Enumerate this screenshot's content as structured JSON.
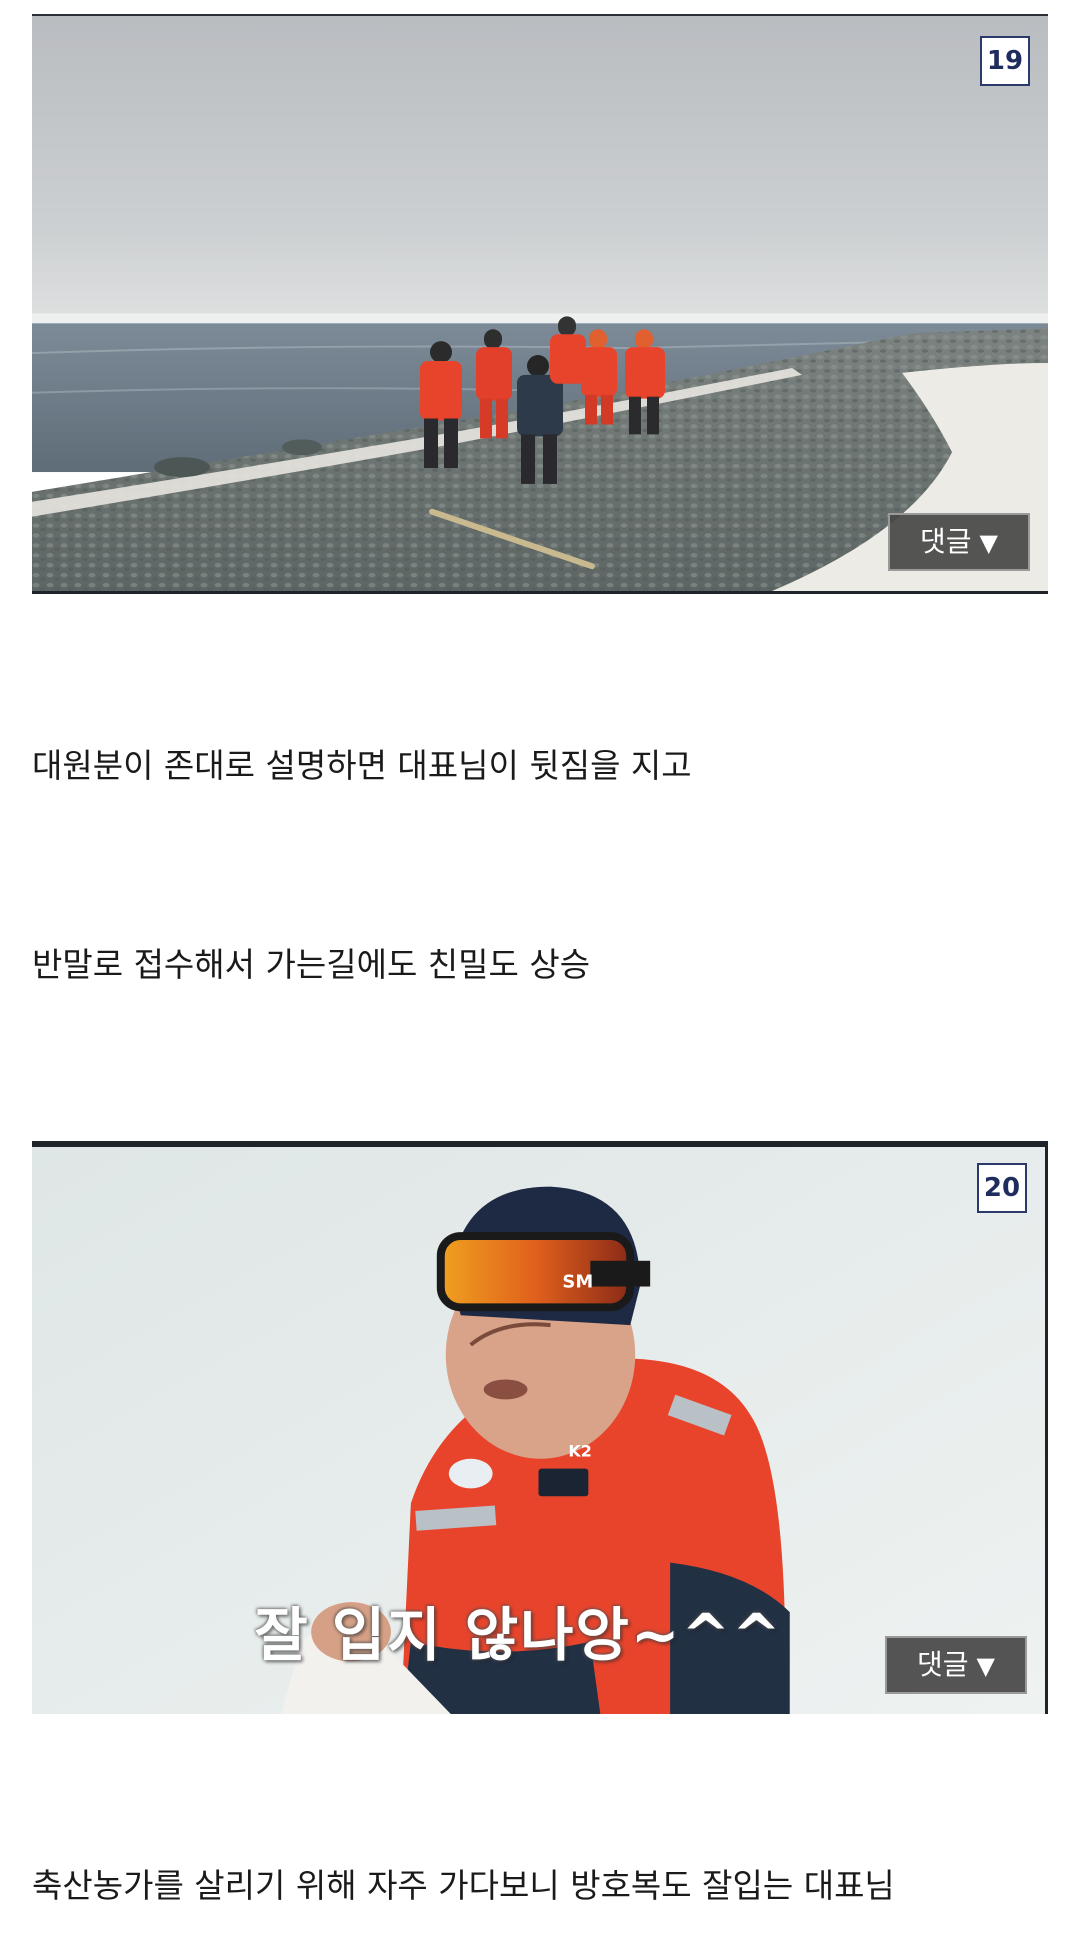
{
  "posts": [
    {
      "number": "19",
      "comment_label": "댓글",
      "comment_arrow": "▼",
      "image_subject": "group-in-red-suits-on-stone-beach"
    },
    {
      "number": "20",
      "comment_label": "댓글",
      "comment_arrow": "▼",
      "image_subject": "man-in-red-parka-and-goggles",
      "subtitle": "잘 입지 않나앙~^^"
    }
  ],
  "captions": [
    "대원분이 존대로 설명하면 대표님이 뒷짐을 지고",
    "반말로 접수해서 가는길에도 친밀도 상승",
    "축산농가를 살리기 위해 자주 가다보니 방호복도 잘입는 대표님"
  ],
  "colors": {
    "badge_border": "#2b3a6b",
    "badge_text": "#1e2d5e",
    "comment_bg": "#464646",
    "suit_red": "#e8442c"
  }
}
